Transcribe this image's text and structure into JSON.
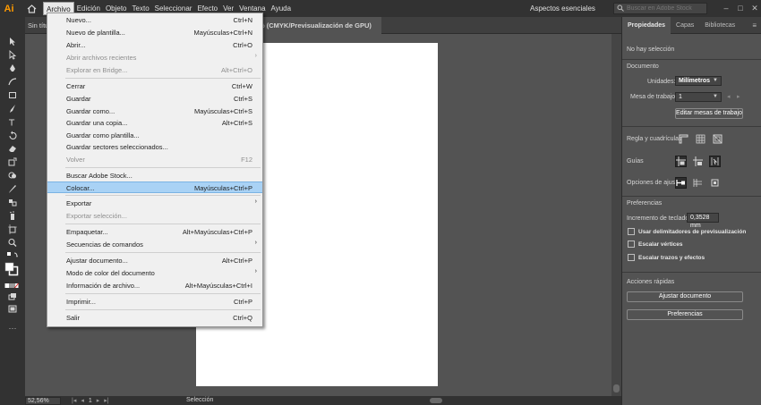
{
  "app": {
    "logo": "Ai",
    "home_icon": "home-icon"
  },
  "menubar": {
    "items": [
      "Archivo",
      "Edición",
      "Objeto",
      "Texto",
      "Seleccionar",
      "Efecto",
      "Ver",
      "Ventana",
      "Ayuda"
    ],
    "active": "Archivo",
    "workspace_label": "Aspectos esenciales",
    "search_placeholder": "Buscar en Adobe Stock"
  },
  "document_tabs": {
    "left_tab": "Sin títu",
    "active_tab": "% (CMYK/Previsualización de GPU)"
  },
  "archivo_menu": {
    "items": [
      {
        "label": "Nuevo...",
        "shortcut": "Ctrl+N",
        "enabled": true
      },
      {
        "label": "Nuevo de plantilla...",
        "shortcut": "Mayúsculas+Ctrl+N",
        "enabled": true
      },
      {
        "label": "Abrir...",
        "shortcut": "Ctrl+O",
        "enabled": true
      },
      {
        "label": "Abrir archivos recientes",
        "shortcut": "",
        "submenu": true,
        "enabled": false
      },
      {
        "label": "Explorar en Bridge...",
        "shortcut": "Alt+Ctrl+O",
        "enabled": false
      },
      {
        "label": "Cerrar",
        "shortcut": "Ctrl+W",
        "enabled": true
      },
      {
        "label": "Guardar",
        "shortcut": "Ctrl+S",
        "enabled": true
      },
      {
        "label": "Guardar como...",
        "shortcut": "Mayúsculas+Ctrl+S",
        "enabled": true
      },
      {
        "label": "Guardar una copia...",
        "shortcut": "Alt+Ctrl+S",
        "enabled": true
      },
      {
        "label": "Guardar como plantilla...",
        "shortcut": "",
        "enabled": true
      },
      {
        "label": "Guardar sectores seleccionados...",
        "shortcut": "",
        "enabled": true
      },
      {
        "label": "Volver",
        "shortcut": "F12",
        "enabled": false
      },
      {
        "label": "Buscar Adobe Stock...",
        "shortcut": "",
        "enabled": true
      },
      {
        "label": "Colocar...",
        "shortcut": "Mayúsculas+Ctrl+P",
        "enabled": true,
        "highlighted": true
      },
      {
        "label": "Exportar",
        "shortcut": "",
        "submenu": true,
        "enabled": true
      },
      {
        "label": "Exportar selección...",
        "shortcut": "",
        "enabled": false
      },
      {
        "label": "Empaquetar...",
        "shortcut": "Alt+Mayúsculas+Ctrl+P",
        "enabled": true
      },
      {
        "label": "Secuencias de comandos",
        "shortcut": "",
        "submenu": true,
        "enabled": true
      },
      {
        "label": "Ajustar documento...",
        "shortcut": "Alt+Ctrl+P",
        "enabled": true
      },
      {
        "label": "Modo de color del documento",
        "shortcut": "",
        "submenu": true,
        "enabled": true
      },
      {
        "label": "Información de archivo...",
        "shortcut": "Alt+Mayúsculas+Ctrl+I",
        "enabled": true
      },
      {
        "label": "Imprimir...",
        "shortcut": "Ctrl+P",
        "enabled": true
      },
      {
        "label": "Salir",
        "shortcut": "Ctrl+Q",
        "enabled": true
      }
    ]
  },
  "panel": {
    "tabs": [
      "Propiedades",
      "Capas",
      "Bibliotecas"
    ],
    "active_tab": "Propiedades",
    "no_selection": "No hay selección",
    "documento_heading": "Documento",
    "unidades_label": "Unidades:",
    "unidades_value": "Milímetros",
    "mesa_label": "Mesa de trabajo:",
    "mesa_value": "1",
    "edit_artboards_button": "Editar mesas de trabajo",
    "reglas_label": "Regla y cuadrículas",
    "guias_label": "Guías",
    "ajuste_label": "Opciones de ajuste",
    "preferencias_heading": "Preferencias",
    "incremento_label": "Incremento de teclado:",
    "incremento_value": "0,3528 mm",
    "checkboxes": [
      {
        "label": "Usar delimitadores de previsualización",
        "checked": false
      },
      {
        "label": "Escalar vértices",
        "checked": false
      },
      {
        "label": "Escalar trazos y efectos",
        "checked": false
      }
    ],
    "acciones_heading": "Acciones rápidas",
    "ajustar_documento_button": "Ajustar documento",
    "preferencias_button": "Preferencias"
  },
  "status": {
    "zoom": "52,56%",
    "page": "1",
    "tool": "Selección"
  },
  "colors": {
    "accent": "#ff9a00",
    "menu_highlight": "#a9d2f5"
  }
}
